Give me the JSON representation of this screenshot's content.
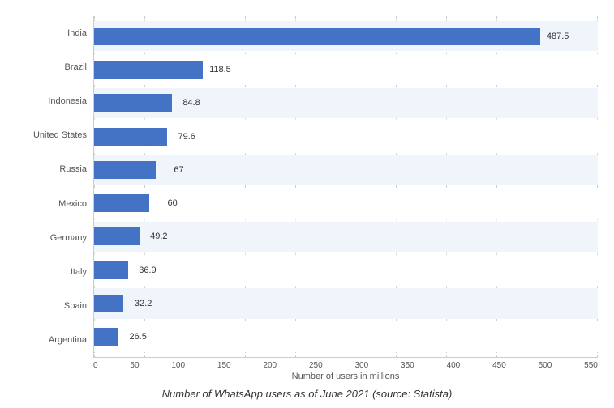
{
  "chart": {
    "title": "Number of WhatsApp users as of June 2021 (source: Statista)",
    "x_axis_title": "Number of users in millions",
    "max_value": 550,
    "x_ticks": [
      "0",
      "50",
      "100",
      "150",
      "200",
      "250",
      "300",
      "350",
      "400",
      "450",
      "500",
      "550"
    ],
    "bars": [
      {
        "country": "India",
        "value": 487.5
      },
      {
        "country": "Brazil",
        "value": 118.5
      },
      {
        "country": "Indonesia",
        "value": 84.8
      },
      {
        "country": "United States",
        "value": 79.6
      },
      {
        "country": "Russia",
        "value": 67
      },
      {
        "country": "Mexico",
        "value": 60
      },
      {
        "country": "Germany",
        "value": 49.2
      },
      {
        "country": "Italy",
        "value": 36.9
      },
      {
        "country": "Spain",
        "value": 32.2
      },
      {
        "country": "Argentina",
        "value": 26.5
      }
    ]
  }
}
